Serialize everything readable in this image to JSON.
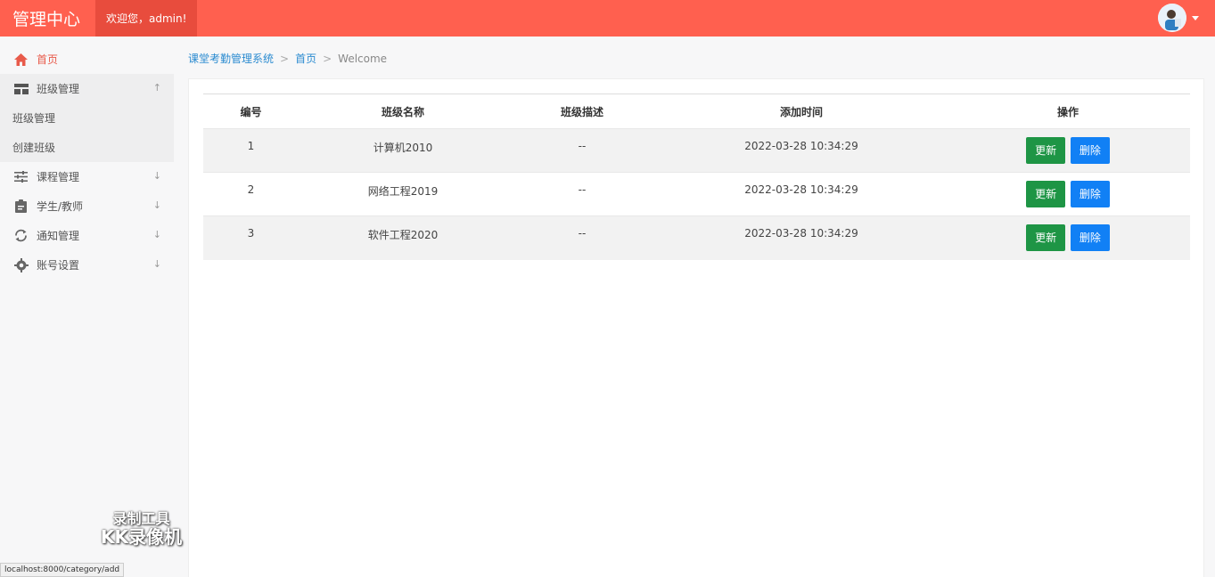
{
  "header": {
    "brand": "管理中心",
    "welcome": "欢迎您，admin!"
  },
  "sidebar": {
    "items": [
      {
        "label": "首页",
        "icon": "home-icon",
        "arrow": ""
      },
      {
        "label": "班级管理",
        "icon": "grid-icon",
        "arrow": "↑"
      },
      {
        "label": "课程管理",
        "icon": "sliders-icon",
        "arrow": "↓"
      },
      {
        "label": "学生/教师",
        "icon": "clipboard-icon",
        "arrow": "↓"
      },
      {
        "label": "通知管理",
        "icon": "refresh-icon",
        "arrow": "↓"
      },
      {
        "label": "账号设置",
        "icon": "gear-icon",
        "arrow": "↓"
      }
    ],
    "sub_items": [
      "班级管理",
      "创建班级"
    ]
  },
  "breadcrumb": {
    "root": "课堂考勤管理系统",
    "home": "首页",
    "current": "Welcome",
    "sep": ">"
  },
  "table": {
    "headers": [
      "编号",
      "班级名称",
      "班级描述",
      "添加时间",
      "操作"
    ],
    "rows": [
      {
        "id": "1",
        "name": "计算机2010",
        "desc": "--",
        "time": "2022-03-28 10:34:29"
      },
      {
        "id": "2",
        "name": "网络工程2019",
        "desc": "--",
        "time": "2022-03-28 10:34:29"
      },
      {
        "id": "3",
        "name": "软件工程2020",
        "desc": "--",
        "time": "2022-03-28 10:34:29"
      }
    ],
    "update_label": "更新",
    "delete_label": "删除"
  },
  "watermark": {
    "line1": "录制工具",
    "line2": "KK录像机"
  },
  "status_url": "localhost:8000/category/add",
  "colors": {
    "header": "#ff604f",
    "update": "#1e9545",
    "delete": "#1180f5",
    "link": "#2b8bd0"
  }
}
